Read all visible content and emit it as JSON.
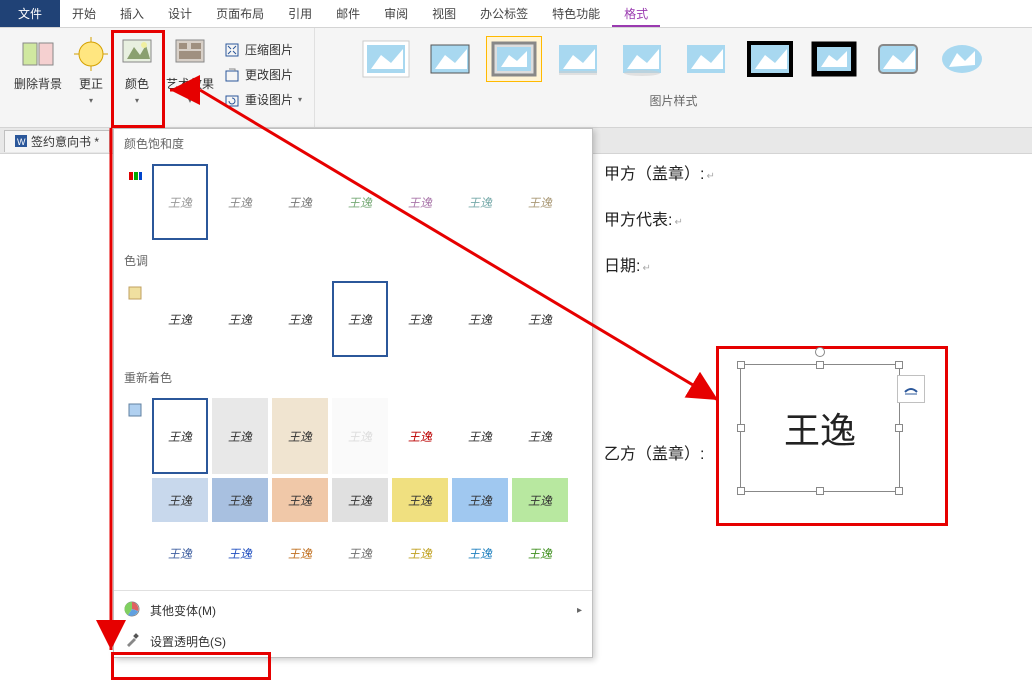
{
  "menu": {
    "file": "文件",
    "home": "开始",
    "insert": "插入",
    "design": "设计",
    "layout": "页面布局",
    "references": "引用",
    "mailings": "邮件",
    "review": "审阅",
    "view": "视图",
    "office_tab": "办公标签",
    "special": "特色功能",
    "format": "格式"
  },
  "ribbon": {
    "remove_bg": "删除背景",
    "corrections": "更正",
    "color": "颜色",
    "artistic": "艺术效果",
    "compress": "压缩图片",
    "change_pic": "更改图片",
    "reset_pic": "重设图片",
    "styles_label": "图片样式"
  },
  "tabs": {
    "doc_name": "签约意向书 *"
  },
  "dropdown": {
    "saturation": "颜色饱和度",
    "tone": "色调",
    "recolor": "重新着色",
    "other_variants": "其他变体(M)",
    "set_transparent": "设置透明色(S)",
    "swatch_glyph": "王逸"
  },
  "doc": {
    "party_a_seal": "甲方（盖章）:",
    "party_a_rep": "甲方代表:",
    "date": "日期:",
    "party_b_seal": "乙方（盖章）:",
    "signature": "王逸"
  }
}
